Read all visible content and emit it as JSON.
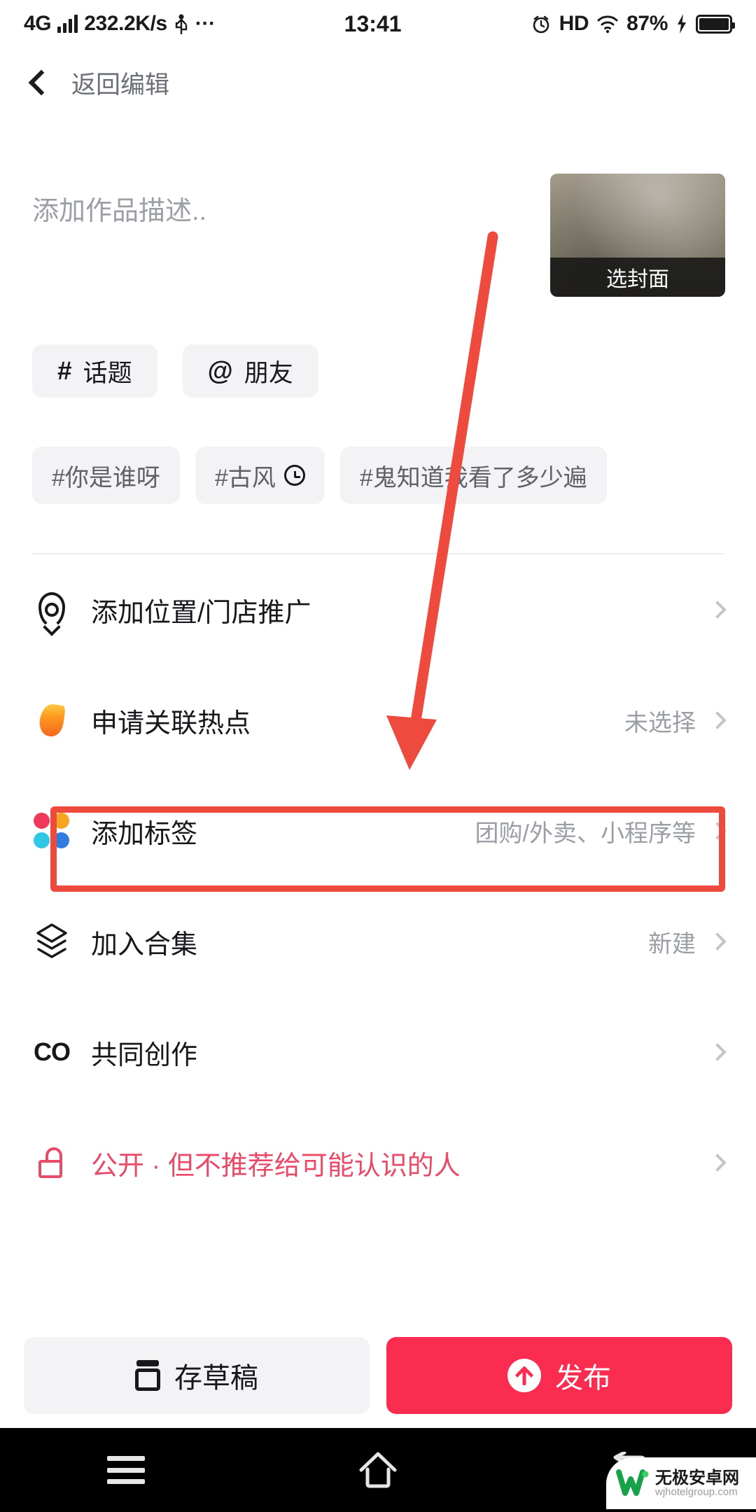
{
  "status_bar": {
    "network_type": "4G",
    "data_speed": "232.2K/s",
    "usb_icon": "usb-icon",
    "more_icon": "ellipsis-icon",
    "time": "13:41",
    "alarm_icon": "alarm-clock-icon",
    "hd_label": "HD",
    "wifi_icon": "wifi-icon",
    "battery_percent": "87%",
    "charging_icon": "lightning-bolt-icon"
  },
  "header": {
    "back_icon": "chevron-left-icon",
    "title": "返回编辑"
  },
  "description": {
    "placeholder": "添加作品描述..",
    "value": ""
  },
  "cover": {
    "label": "选封面"
  },
  "chips": [
    {
      "symbol": "#",
      "label": "话题",
      "name": "topic-chip"
    },
    {
      "symbol": "@",
      "label": "朋友",
      "name": "friend-chip"
    }
  ],
  "tags": [
    {
      "label": "#你是谁呀",
      "has_clock": false
    },
    {
      "label": "#古风",
      "has_clock": true
    },
    {
      "label": "#鬼知道我看了多少遍",
      "has_clock": false
    }
  ],
  "settings": [
    {
      "icon": "location-pin-icon",
      "label": "添加位置/门店推广",
      "value": "",
      "highlighted": false
    },
    {
      "icon": "flame-icon",
      "label": "申请关联热点",
      "value": "未选择",
      "highlighted": false
    },
    {
      "icon": "four-dots-icon",
      "label": "添加标签",
      "value": "团购/外卖、小程序等",
      "highlighted": true
    },
    {
      "icon": "layers-icon",
      "label": "加入合集",
      "value": "新建",
      "highlighted": false
    },
    {
      "icon": "co-create-icon",
      "label": "共同创作",
      "value": "",
      "highlighted": false
    },
    {
      "icon": "unlock-icon",
      "label": "公开 · 但不推荐给可能认识的人",
      "value": "",
      "highlighted": false
    }
  ],
  "bottom_buttons": {
    "draft_label": "存草稿",
    "draft_icon": "save-draft-icon",
    "publish_label": "发布",
    "publish_icon": "upload-arrow-icon"
  },
  "nav_bar": {
    "menu_icon": "menu-icon",
    "home_icon": "home-icon",
    "back_icon": "back-icon"
  },
  "watermark": {
    "title": "无极安卓网",
    "url": "wjhotelgroup.com",
    "logo_icon": "w-logo-icon"
  },
  "colors": {
    "publish_red": "#fa2c50",
    "annotation_red": "#ee4a3e",
    "privacy_pink": "#ea4a68",
    "chip_bg": "#f3f3f5",
    "muted_text": "#9a9ea5"
  },
  "annotation": {
    "arrow_color": "#ee4a3e",
    "highlight_color": "#ee4a3e",
    "arrow_target": "添加标签"
  }
}
